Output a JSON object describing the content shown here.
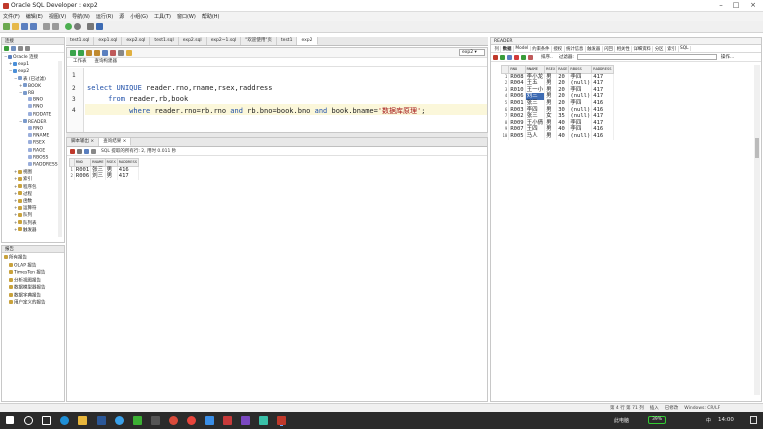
{
  "window": {
    "title": "Oracle SQL Developer : exp2"
  },
  "menu": [
    "文件(F)",
    "编辑(E)",
    "视图(V)",
    "导航(N)",
    "运行(R)",
    "源",
    "小组(G)",
    "工具(T)",
    "窗口(W)",
    "帮助(H)"
  ],
  "connections": {
    "header": "连接",
    "items": [
      {
        "label": "Oracle 连接",
        "indent": 0,
        "expand": "−",
        "color": "#5a7fbf"
      },
      {
        "label": "exp1",
        "indent": 1,
        "expand": "+",
        "color": "#4a8fd8"
      },
      {
        "label": "exp2",
        "indent": 1,
        "expand": "−",
        "color": "#4a8fd8"
      },
      {
        "label": "表 (已过滤)",
        "indent": 2,
        "expand": "−",
        "color": "#7a9acb"
      },
      {
        "label": "BOOK",
        "indent": 3,
        "expand": "+",
        "color": "#7a9acb"
      },
      {
        "label": "RB",
        "indent": 3,
        "expand": "−",
        "color": "#7a9acb"
      },
      {
        "label": "BNO",
        "indent": 4,
        "expand": "",
        "color": "#9aaedb"
      },
      {
        "label": "RNO",
        "indent": 4,
        "expand": "",
        "color": "#9aaedb"
      },
      {
        "label": "RDDATE",
        "indent": 4,
        "expand": "",
        "color": "#9aaedb"
      },
      {
        "label": "READER",
        "indent": 3,
        "expand": "−",
        "color": "#7a9acb"
      },
      {
        "label": "RNO",
        "indent": 4,
        "expand": "",
        "color": "#9aaedb"
      },
      {
        "label": "RNAME",
        "indent": 4,
        "expand": "",
        "color": "#9aaedb"
      },
      {
        "label": "RSEX",
        "indent": 4,
        "expand": "",
        "color": "#9aaedb"
      },
      {
        "label": "RAGE",
        "indent": 4,
        "expand": "",
        "color": "#9aaedb"
      },
      {
        "label": "RBOSS",
        "indent": 4,
        "expand": "",
        "color": "#9aaedb"
      },
      {
        "label": "RADDRESS",
        "indent": 4,
        "expand": "",
        "color": "#9aaedb"
      },
      {
        "label": "视图",
        "indent": 2,
        "expand": "+",
        "color": "#c9a23c"
      },
      {
        "label": "索引",
        "indent": 2,
        "expand": "+",
        "color": "#c9a23c"
      },
      {
        "label": "程序包",
        "indent": 2,
        "expand": "+",
        "color": "#c9a23c"
      },
      {
        "label": "过程",
        "indent": 2,
        "expand": "+",
        "color": "#c9a23c"
      },
      {
        "label": "函数",
        "indent": 2,
        "expand": "+",
        "color": "#c9a23c"
      },
      {
        "label": "运算符",
        "indent": 2,
        "expand": "+",
        "color": "#c9a23c"
      },
      {
        "label": "队列",
        "indent": 2,
        "expand": "+",
        "color": "#c9a23c"
      },
      {
        "label": "队列表",
        "indent": 2,
        "expand": "+",
        "color": "#c9a23c"
      },
      {
        "label": "触发器",
        "indent": 2,
        "expand": "+",
        "color": "#c9a23c"
      }
    ]
  },
  "reports": {
    "header": "报告",
    "items": [
      {
        "label": "所有报告",
        "indent": 0
      },
      {
        "label": "OLAP 报告",
        "indent": 1
      },
      {
        "label": "TimesTen 报告",
        "indent": 1
      },
      {
        "label": "分析视图报告",
        "indent": 1
      },
      {
        "label": "数据模型器报告",
        "indent": 1
      },
      {
        "label": "数据字典报告",
        "indent": 1
      },
      {
        "label": "用户定义的报告",
        "indent": 1
      }
    ]
  },
  "editor_tabs": [
    "test1.sql",
    "exp1.sql",
    "exp2.sql",
    "test1.sql",
    "exp2.sql",
    "exp2~1.sql",
    "\"欢迎使用\"页",
    "test1",
    "exp2"
  ],
  "editor": {
    "subtabs": [
      "工作表",
      "查询构建器"
    ],
    "conn": "exp2",
    "lines": [
      {
        "n": "1",
        "parts": [
          {
            "t": "",
            "c": ""
          }
        ]
      },
      {
        "n": "2",
        "parts": [
          {
            "t": "select ",
            "c": "kw"
          },
          {
            "t": "UNIQUE",
            "c": "kw"
          },
          {
            "t": " reader.rno,rname,rsex,raddress",
            "c": ""
          }
        ]
      },
      {
        "n": "3",
        "parts": [
          {
            "t": "     from ",
            "c": "kw"
          },
          {
            "t": "reader,rb,book",
            "c": ""
          }
        ]
      },
      {
        "n": "4",
        "parts": [
          {
            "t": "          where ",
            "c": "kw"
          },
          {
            "t": "reader.rno=rb.rno ",
            "c": ""
          },
          {
            "t": "and",
            "c": "kw"
          },
          {
            "t": " rb.bno=book.bno ",
            "c": ""
          },
          {
            "t": "and",
            "c": "kw"
          },
          {
            "t": " book.bname=",
            "c": ""
          },
          {
            "t": "'数据库原理'",
            "c": "str"
          },
          {
            "t": ";",
            "c": ""
          }
        ]
      }
    ]
  },
  "result": {
    "tabs": [
      "脚本输出 ×",
      "查询结果 ×"
    ],
    "status": "SQL  提取的所有行: 2, 用时 0.011 秒",
    "columns": [
      "RNO",
      "RNAME",
      "RSEX",
      "RADDRESS"
    ],
    "rows": [
      {
        "i": "1",
        "cells": [
          "R001",
          "张三",
          "男",
          "416"
        ]
      },
      {
        "i": "2",
        "cells": [
          "R006",
          "刘三",
          "男",
          "417"
        ]
      }
    ]
  },
  "reader": {
    "title": "READER",
    "tabs": [
      "列",
      "数据",
      "Model",
      "约束条件",
      "授权",
      "统计信息",
      "触发器",
      "闪回",
      "相关性",
      "详细资料",
      "分区",
      "索引",
      "SQL"
    ],
    "actions": [
      "操作..."
    ],
    "sort_label": "排序..",
    "filter_label": "过滤器:",
    "columns": [
      "RNO",
      "RNAME",
      "RSEX",
      "RAGE",
      "RBOSS",
      "RADDRESS"
    ],
    "rows": [
      {
        "i": "1",
        "cells": [
          "R008",
          "李小龙",
          "男",
          "20",
          "李四",
          "417"
        ]
      },
      {
        "i": "2",
        "cells": [
          "R004",
          "王五",
          "男",
          "20",
          "(null)",
          "417"
        ]
      },
      {
        "i": "3",
        "cells": [
          "R010",
          "王一小",
          "男",
          "20",
          "李四",
          "417"
        ]
      },
      {
        "i": "4",
        "cells": [
          "R006",
          "刘三",
          "男",
          "20",
          "(null)",
          "417"
        ]
      },
      {
        "i": "5",
        "cells": [
          "R001",
          "张三",
          "男",
          "20",
          "李四",
          "416"
        ]
      },
      {
        "i": "6",
        "cells": [
          "R003",
          "李四",
          "男",
          "30",
          "(null)",
          "416"
        ]
      },
      {
        "i": "7",
        "cells": [
          "R002",
          "张三",
          "女",
          "35",
          "(null)",
          "417"
        ]
      },
      {
        "i": "8",
        "cells": [
          "R009",
          "王小倩",
          "男",
          "40",
          "李四",
          "417"
        ]
      },
      {
        "i": "9",
        "cells": [
          "R007",
          "王四",
          "男",
          "40",
          "李四",
          "416"
        ]
      },
      {
        "i": "10",
        "cells": [
          "R005",
          "马人",
          "男",
          "40",
          "(null)",
          "416"
        ]
      }
    ],
    "selected_row": 4
  },
  "statusbar": {
    "right_a": "第 4 行 第 71 列",
    "right_b": "插入",
    "right_c": "已修改",
    "right_d": "Windows: CR/LF",
    "right_e": "编辑"
  },
  "taskbar": {
    "clock": "14:00",
    "tray_label": "此电脑",
    "battery": "39%",
    "lang": "中"
  }
}
